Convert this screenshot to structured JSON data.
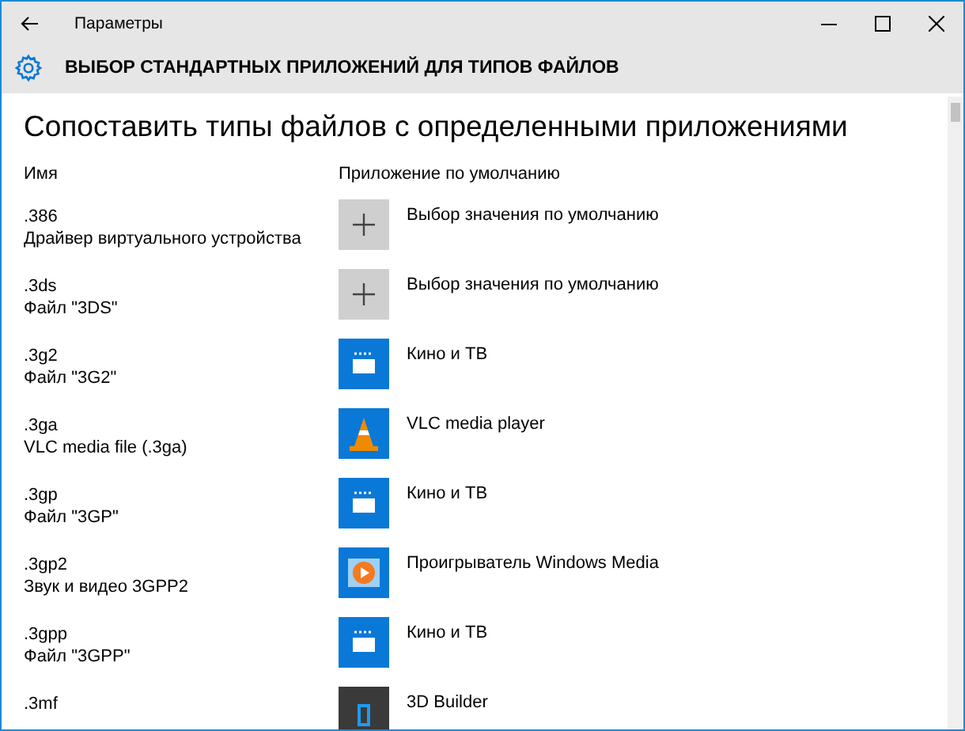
{
  "window": {
    "title": "Параметры"
  },
  "header": {
    "title": "ВЫБОР СТАНДАРТНЫХ ПРИЛОЖЕНИЙ ДЛЯ ТИПОВ ФАЙЛОВ"
  },
  "heading": "Сопоставить типы файлов с определенными приложениями",
  "columns": [
    "Имя",
    "Приложение по умолчанию"
  ],
  "rows": [
    {
      "extension": ".386",
      "description": "Драйвер виртуального устройства",
      "app": {
        "kind": "add",
        "name": "Выбор значения по умолчанию"
      }
    },
    {
      "extension": ".3ds",
      "description": "Файл \"3DS\"",
      "app": {
        "kind": "add",
        "name": "Выбор значения по умолчанию"
      }
    },
    {
      "extension": ".3g2",
      "description": "Файл \"3G2\"",
      "app": {
        "kind": "movies",
        "name": "Кино и ТВ"
      }
    },
    {
      "extension": ".3ga",
      "description": "VLC media file (.3ga)",
      "app": {
        "kind": "vlc",
        "name": "VLC media player"
      }
    },
    {
      "extension": ".3gp",
      "description": "Файл \"3GP\"",
      "app": {
        "kind": "movies",
        "name": "Кино и ТВ"
      }
    },
    {
      "extension": ".3gp2",
      "description": "Звук и видео 3GPP2",
      "app": {
        "kind": "wmp",
        "name": "Проигрыватель Windows Media"
      }
    },
    {
      "extension": ".3gpp",
      "description": "Файл \"3GPP\"",
      "app": {
        "kind": "movies",
        "name": "Кино и ТВ"
      }
    },
    {
      "extension": ".3mf",
      "app": {
        "kind": "builder",
        "name": "3D Builder"
      }
    }
  ]
}
